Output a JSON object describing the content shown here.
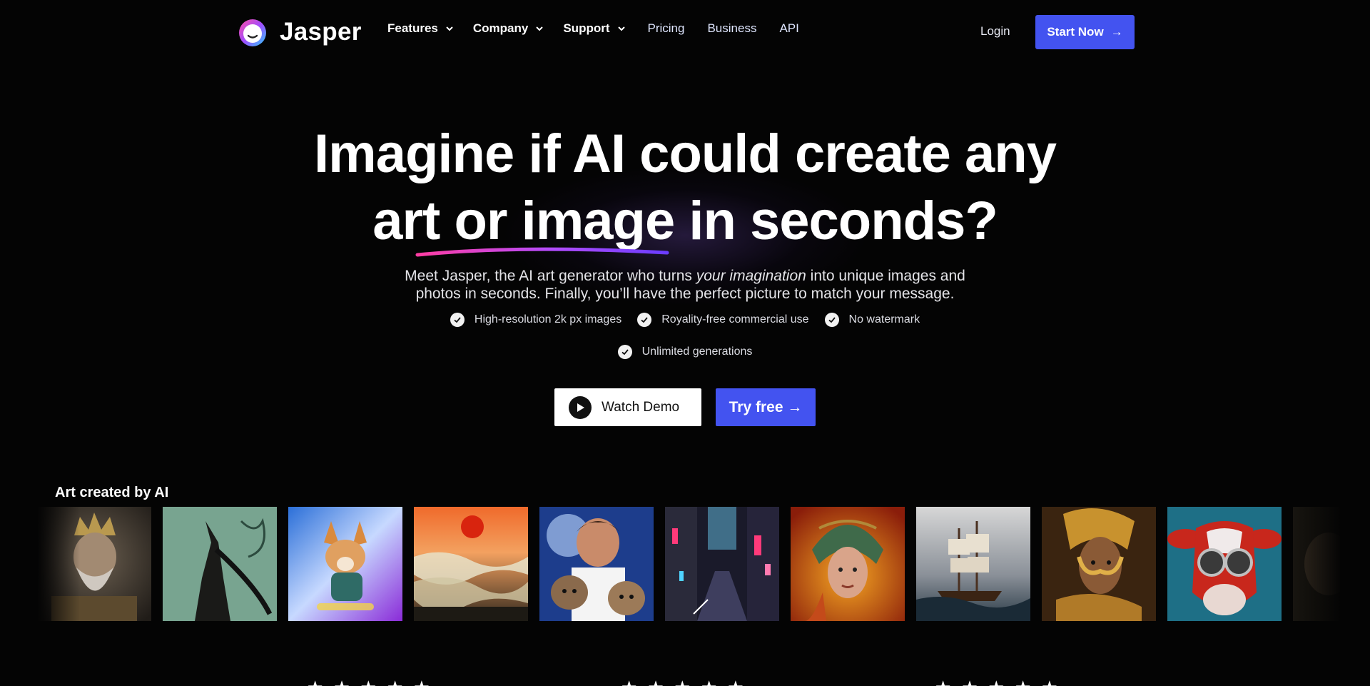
{
  "nav": {
    "logo_text": "Jasper",
    "dropdowns": [
      {
        "label": "Features"
      },
      {
        "label": "Company"
      },
      {
        "label": "Support"
      }
    ],
    "links": [
      "Pricing",
      "Business",
      "API"
    ],
    "login": "Login",
    "start_now": "Start Now",
    "start_arrow": "→"
  },
  "hero": {
    "line1": "Imagine if AI could create any",
    "line2": "art or image in seconds?",
    "sub_part1": "Meet Jasper, the AI art generator who turns ",
    "sub_em": "your imagination",
    "sub_part2": " into unique images and",
    "sub_line2": "photos in seconds. Finally, you’ll have the perfect picture to match your message.",
    "features": [
      "High-resolution 2k px images",
      "Royality-free commercial use",
      "No watermark",
      "Unlimited generations"
    ],
    "watch_demo": "Watch Demo",
    "try_free": "Try free →"
  },
  "gallery": {
    "title": "Art created by AI",
    "images": [
      "king-portrait-image",
      "dark-creature-image",
      "corgi-image",
      "ocean-sunset-image",
      "man-with-kittens-image",
      "neon-city-image",
      "warrior-woman-image",
      "sailing-ship-image",
      "golden-woman-image",
      "cow-sunglasses-image",
      "faded-portrait-image"
    ]
  },
  "colors": {
    "background": "#040404",
    "accent": "#4353f0"
  }
}
